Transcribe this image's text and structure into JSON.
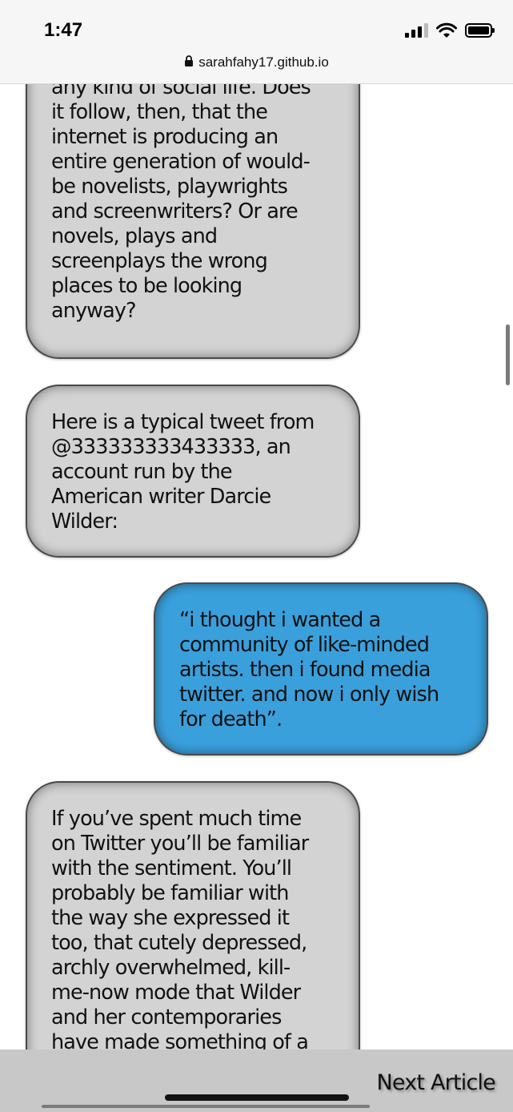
{
  "status_bar": {
    "time": "1:47"
  },
  "browser": {
    "url": "sarahfahy17.github.io"
  },
  "messages": [
    {
      "side": "left",
      "color": "gray",
      "text": "any kind of social life. Does\nit follow, then, that the\ninternet is producing an\nentire generation of would-\nbe novelists, playwrights\nand screenwriters? Or are\nnovels, plays and\nscreenplays the wrong\nplaces to be looking\nanyway?"
    },
    {
      "side": "left",
      "color": "gray",
      "text": "Here is a typical tweet from\n@333333333433333, an\naccount run by the\nAmerican writer Darcie\nWilder:"
    },
    {
      "side": "right",
      "color": "blue",
      "text": "“i thought i wanted a\ncommunity of like-minded\nartists. then i found media\ntwitter. and now i only wish\nfor death”."
    },
    {
      "side": "left",
      "color": "gray",
      "text": "If you’ve spent much time\non Twitter you’ll be familiar\nwith the sentiment. You’ll\nprobably be familiar with\nthe way she expressed it\ntoo, that cutely depressed,\narchly overwhelmed, kill-\nme-now mode that Wilder\nand her contemporaries\nhave made something of a"
    }
  ],
  "footer": {
    "next_label": "Next Article"
  },
  "colors": {
    "bubble_gray": "#d3d3d3",
    "bubble_blue": "#3aa0dc",
    "footer_bg": "#c8c8c8"
  }
}
